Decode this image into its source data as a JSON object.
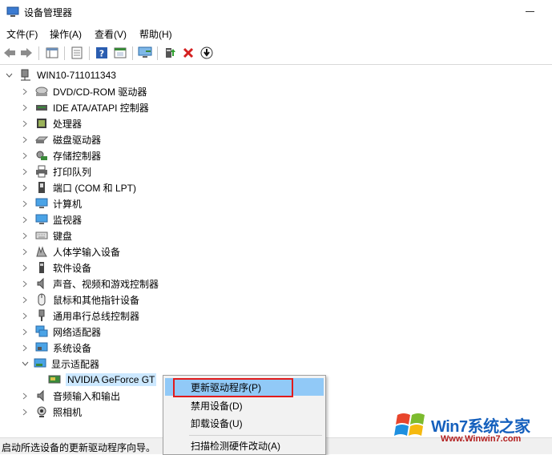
{
  "window": {
    "title": "设备管理器"
  },
  "menu": [
    "文件(F)",
    "操作(A)",
    "查看(V)",
    "帮助(H)"
  ],
  "toolbar": [
    "back-icon",
    "forward-icon",
    "properties-grid-icon",
    "view-icon",
    "help-icon",
    "show-icon",
    "monitor-icon",
    "update-driver-icon",
    "uninstall-icon",
    "download-icon"
  ],
  "tree": {
    "root": "WIN10-711011343",
    "categories": [
      "DVD/CD-ROM 驱动器",
      "IDE ATA/ATAPI 控制器",
      "处理器",
      "磁盘驱动器",
      "存储控制器",
      "打印队列",
      "端口 (COM 和 LPT)",
      "计算机",
      "监视器",
      "键盘",
      "人体学输入设备",
      "软件设备",
      "声音、视频和游戏控制器",
      "鼠标和其他指针设备",
      "通用串行总线控制器",
      "网络适配器",
      "系统设备",
      "显示适配器"
    ],
    "child": "NVIDIA GeForce GT",
    "after": [
      "音频输入和输出",
      "照相机"
    ]
  },
  "context_menu": {
    "items": [
      "更新驱动程序(P)",
      "禁用设备(D)",
      "卸载设备(U)",
      "扫描检测硬件改动(A)"
    ]
  },
  "status": "启动所选设备的更新驱动程序向导。",
  "watermark": {
    "brand": "Win7系统之家",
    "site": "Www.Winwin7.com"
  },
  "colors": {
    "highlight": "#91c9f7",
    "selection": "#cce8ff",
    "annotation": "#e21b1b"
  }
}
